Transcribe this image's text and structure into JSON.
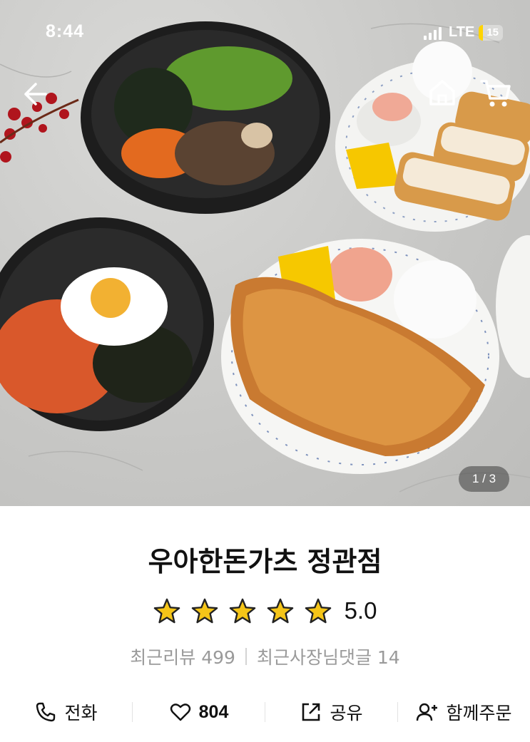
{
  "status_bar": {
    "time": "8:44",
    "network": "LTE",
    "battery": "15"
  },
  "top_nav": {
    "back_icon": "arrow-left-icon",
    "home_icon": "home-icon",
    "cart_icon": "cart-icon"
  },
  "gallery": {
    "pager": "1 / 3"
  },
  "store": {
    "name": "우아한돈가츠 정관점",
    "rating": "5.0",
    "rating_stars": 5,
    "star_color": "#F5C518",
    "recent_reviews_label": "최근리뷰 499",
    "owner_replies_label": "최근사장님댓글 14"
  },
  "actions": [
    {
      "label": "전화",
      "icon": "phone-icon"
    },
    {
      "label": "804",
      "icon": "heart-icon"
    },
    {
      "label": "공유",
      "icon": "share-icon"
    },
    {
      "label": "함께주문",
      "icon": "add-user-icon"
    }
  ]
}
